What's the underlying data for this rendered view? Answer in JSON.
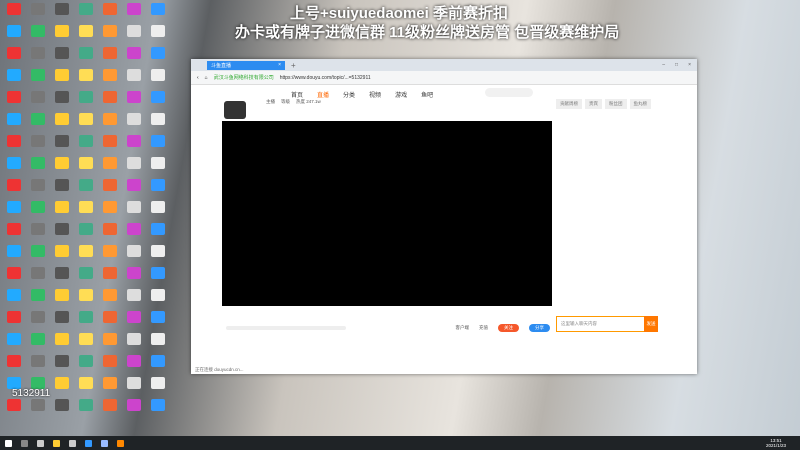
{
  "overlay": {
    "line1": "上号+suiyuedaomei 季前赛折扣",
    "line2": "办卡或有牌子进微信群 11级粉丝牌送房管  包晋级赛维护局"
  },
  "desktop": {
    "icon_colors": [
      "#e33",
      "#4a8",
      "#39f",
      "#fc3",
      "#ddd",
      "#777",
      "#e63",
      "#2af",
      "#fd5",
      "#eee",
      "#555",
      "#c4c",
      "#3b6",
      "#f93"
    ]
  },
  "browser": {
    "tab_title": "斗鱼直播",
    "url_site": "武汉斗鱼网络科技有限公司",
    "url": "https://www.douyu.com/topic/...=5132911",
    "nav": [
      "首页",
      "直播",
      "分类",
      "视频",
      "游戏",
      "鱼吧"
    ],
    "active_nav": "直播",
    "room_info": [
      "主播",
      "等级",
      "热度 247.1w"
    ],
    "side_tabs": [
      "贡献周榜",
      "贵宾",
      "粉丝团",
      "鱼丸榜"
    ],
    "chat_placeholder": "这里输入聊天内容",
    "send_label": "发送",
    "bottom_actions": [
      "客户端",
      "充值"
    ],
    "bottom_pills": [
      "关注",
      "分享"
    ],
    "status_text": "正在连接 douyucdn.cn..."
  },
  "watermark": "5132911",
  "clock": {
    "time": "13:51",
    "date": "2021/1/23"
  }
}
